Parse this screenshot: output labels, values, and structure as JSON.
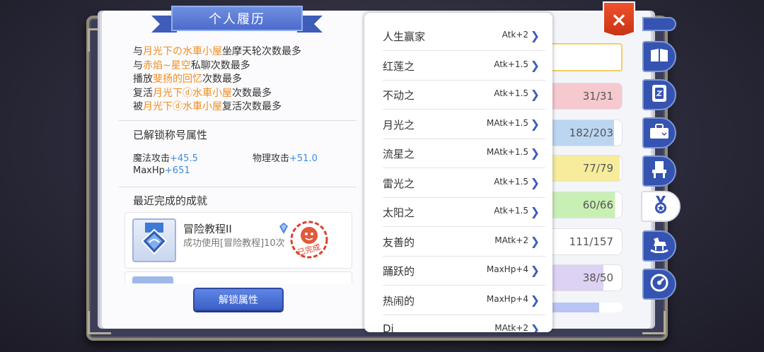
{
  "title": "个人履历",
  "history": [
    [
      {
        "t": "与",
        "h": false
      },
      {
        "t": "月光下の水車小屋",
        "h": true
      },
      {
        "t": "坐摩天轮次数最多",
        "h": false
      }
    ],
    [
      {
        "t": "与",
        "h": false
      },
      {
        "t": "赤焰~星空",
        "h": true
      },
      {
        "t": "私聊次数最多",
        "h": false
      }
    ],
    [
      {
        "t": "播放",
        "h": false
      },
      {
        "t": "斐扬的回忆",
        "h": true
      },
      {
        "t": "次数最多",
        "h": false
      }
    ],
    [
      {
        "t": "复活",
        "h": false
      },
      {
        "t": "月光下ⓓ水車小屋",
        "h": true
      },
      {
        "t": "次数最多",
        "h": false
      }
    ],
    [
      {
        "t": "被",
        "h": false
      },
      {
        "t": "月光下ⓓ水車小屋",
        "h": true
      },
      {
        "t": "复活次数最多",
        "h": false
      }
    ]
  ],
  "unlocked_title_attrs": {
    "heading": "已解锁称号属性",
    "stats": [
      {
        "label": "魔法攻击",
        "value": "+45.5"
      },
      {
        "label": "物理攻击",
        "value": "+51.0"
      },
      {
        "label": "MaxHp",
        "value": "+651"
      }
    ]
  },
  "recent_achievements": {
    "heading": "最近完成的成就",
    "items": [
      {
        "name": "冒险教程II",
        "desc": "成功使用[冒险教程]10次",
        "stamp": "已完成"
      }
    ]
  },
  "unlock_button": "解锁属性",
  "title_list": [
    {
      "name": "人生赢家",
      "bonus": "Atk+2"
    },
    {
      "name": "红莲之",
      "bonus": "Atk+1.5"
    },
    {
      "name": "不动之",
      "bonus": "Atk+1.5"
    },
    {
      "name": "月光之",
      "bonus": "MAtk+1.5"
    },
    {
      "name": "流星之",
      "bonus": "MAtk+1.5"
    },
    {
      "name": "雷光之",
      "bonus": "Atk+1.5"
    },
    {
      "name": "太阳之",
      "bonus": "Atk+1.5"
    },
    {
      "name": "友善的",
      "bonus": "MAtk+2"
    },
    {
      "name": "踊跃的",
      "bonus": "MaxHp+4"
    },
    {
      "name": "热闹的",
      "bonus": "MaxHp+4"
    },
    {
      "name": "Di",
      "bonus": "MAtk+2"
    }
  ],
  "progress_bars": [
    {
      "text": "31/31",
      "fraction": 1.0,
      "color": "#f6c9cf"
    },
    {
      "text": "182/203",
      "fraction": 0.9,
      "color": "#bcd6f2"
    },
    {
      "text": "77/79",
      "fraction": 0.97,
      "color": "#f6ec9c"
    },
    {
      "text": "60/66",
      "fraction": 0.91,
      "color": "#c9f0b4"
    },
    {
      "text": "111/157",
      "fraction": 0.71,
      "color": "#ffffff"
    },
    {
      "text": "38/50",
      "fraction": 0.76,
      "color": "#ddd1f4"
    }
  ],
  "side_tabs": [
    "map-icon",
    "book-icon",
    "card-icon",
    "chest-icon",
    "throne-icon",
    "medal-icon",
    "rocking-horse-icon",
    "gauge-icon"
  ],
  "close_label": "×"
}
